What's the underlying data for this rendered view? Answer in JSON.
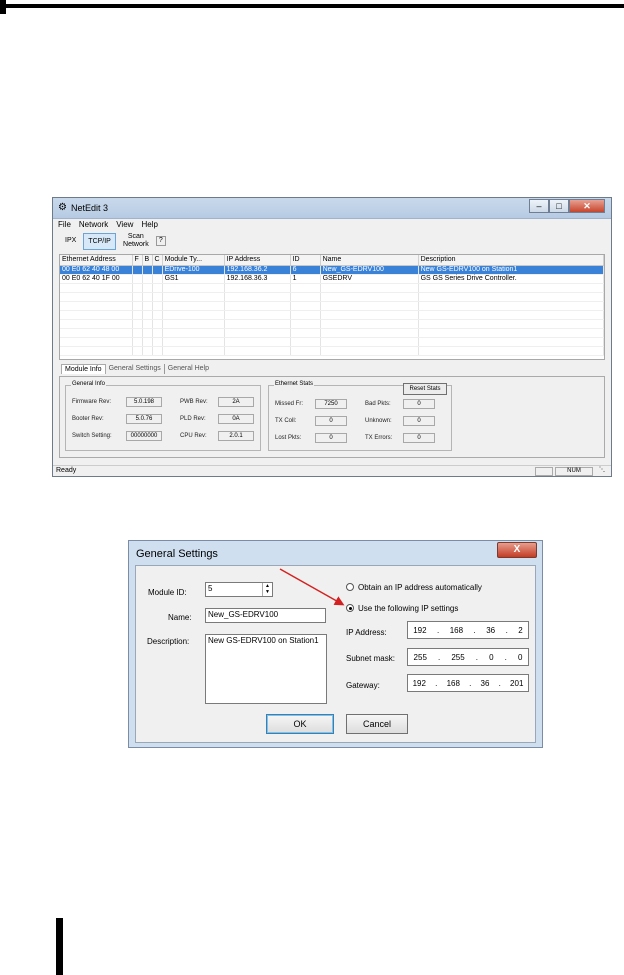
{
  "netedit": {
    "title": "NetEdit 3",
    "menu": [
      "File",
      "Network",
      "View",
      "Help"
    ],
    "toolbar": {
      "ipx": "IPX",
      "tcpip": "TCP/IP",
      "scan": "Scan Network",
      "help": "?"
    },
    "columns": [
      "Ethernet Address",
      "F",
      "B",
      "C",
      "Module Ty...",
      "IP Address",
      "ID",
      "Name",
      "Description"
    ],
    "rows": [
      {
        "mac": "00 E0 62 40 48 00",
        "f": "",
        "b": "",
        "c": "",
        "type": "EDrive-100",
        "ip": "192.168.36.2",
        "id": "6",
        "name": "New_GS-EDRV100",
        "desc": "New GS-EDRV100 on Station1",
        "selected": true
      },
      {
        "mac": "00 E0 62 40 1F 00",
        "f": "",
        "b": "",
        "c": "",
        "type": "GS1",
        "ip": "192.168.36.3",
        "id": "1",
        "name": "GSEDRV",
        "desc": "GS GS Series Drive Controller.",
        "selected": false
      }
    ],
    "tabs": [
      "Module Info",
      "General Settings",
      "General Help"
    ],
    "general_info": {
      "title": "General Info",
      "firmware_label": "Firmware Rev:",
      "firmware": "5.0.198",
      "booter_label": "Booter Rev:",
      "booter": "5.0.76",
      "switch_label": "Switch Setting:",
      "switch": "00000000",
      "pwb_label": "PWB Rev:",
      "pwb": "2A",
      "pld_label": "PLD Rev:",
      "pld": "0A",
      "cpu_label": "CPU Rev:",
      "cpu": "2.0.1"
    },
    "ethernet_stats": {
      "title": "Ethernet Stats",
      "reset": "Reset Stats",
      "missed_label": "Missed Fr:",
      "missed": "7250",
      "txcoll_label": "TX Coll:",
      "txcoll": "0",
      "lost_label": "Lost Pkts:",
      "lost": "0",
      "bad_label": "Bad Pkts:",
      "bad": "0",
      "unknown_label": "Unknown:",
      "unknown": "0",
      "txerr_label": "TX Errors:",
      "txerr": "0"
    },
    "status": {
      "text": "Ready",
      "num": "NUM"
    }
  },
  "dialog": {
    "title": "General Settings",
    "close": "X",
    "module_id_label": "Module ID:",
    "module_id": "5",
    "name_label": "Name:",
    "name": "New_GS-EDRV100",
    "description_label": "Description:",
    "description": "New GS-EDRV100 on Station1",
    "radio_auto": "Obtain an IP address automatically",
    "radio_manual": "Use the following IP settings",
    "ip_label": "IP Address:",
    "ip": [
      "192",
      "168",
      "36",
      "2"
    ],
    "mask_label": "Subnet mask:",
    "mask": [
      "255",
      "255",
      "0",
      "0"
    ],
    "gw_label": "Gateway:",
    "gw": [
      "192",
      "168",
      "36",
      "201"
    ],
    "ok": "OK",
    "cancel": "Cancel",
    "colors": {
      "arrow": "#d42020"
    }
  }
}
